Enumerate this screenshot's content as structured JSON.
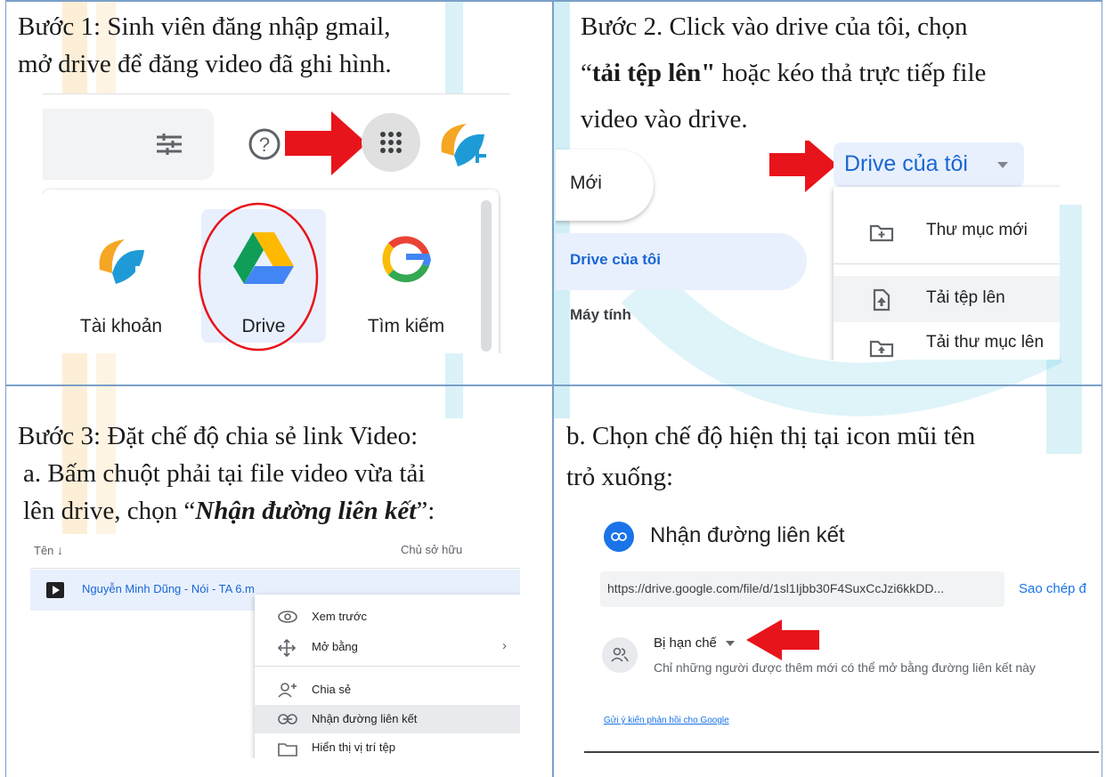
{
  "step1": {
    "line1": "Bước 1: Sinh viên đăng nhập gmail,",
    "line2": "mở drive để đăng video đã ghi hình.",
    "apps": [
      {
        "label": "Tài khoản"
      },
      {
        "label": "Drive"
      },
      {
        "label": "Tìm kiếm"
      }
    ]
  },
  "step2": {
    "line1": "Bước 2. Click vào drive của tôi, chọn",
    "quote_open": "“",
    "bold_text": "tải tệp lên\"",
    "line2_rest": " hoặc kéo thả trực tiếp file",
    "line3": "video vào drive.",
    "new_button": "Mới",
    "nav_my_drive": "Drive của tôi",
    "nav_computers": "Máy tính",
    "header_dropdown": "Drive của tôi",
    "menu": [
      "Thư mục mới",
      "Tải tệp lên",
      "Tải thư mục lên"
    ]
  },
  "step3": {
    "line1": "Bước 3: Đặt chế độ chia sẻ link Video:",
    "line2": "a. Bấm chuột phải tại file video vừa tải",
    "line3_pre": "lên drive, chọn “",
    "line3_bi": "Nhận đường liên kết",
    "line3_post": "”:",
    "col_name": "Tên",
    "col_owner": "Chủ sở hữu",
    "file_name": "Nguyễn Minh Dũng - Nói - TA 6.m",
    "context_menu": [
      "Xem trước",
      "Mở bằng",
      "Chia sẻ",
      "Nhận đường liên kết",
      "Hiển thị vị trí tệp"
    ]
  },
  "step3b": {
    "line1": "b. Chọn chế độ hiện thị tại icon mũi tên",
    "line2": "trỏ xuống:",
    "dialog_title": "Nhận đường liên kết",
    "link": "https://drive.google.com/file/d/1sl1Ijbb30F4SuxCcJzi6kkDD...",
    "copy_button": "Sao chép đ",
    "access_level": "Bị hạn chế",
    "access_desc": "Chỉ những người được thêm mới có thể mở bằng đường liên kết này",
    "feedback": "Gửi ý kiến phản hồi cho Google"
  },
  "colors": {
    "grid": "#7aa0c8",
    "arrow_red": "#e8141b",
    "drive_blue": "#1967d2",
    "link_blue": "#1a73e8"
  }
}
